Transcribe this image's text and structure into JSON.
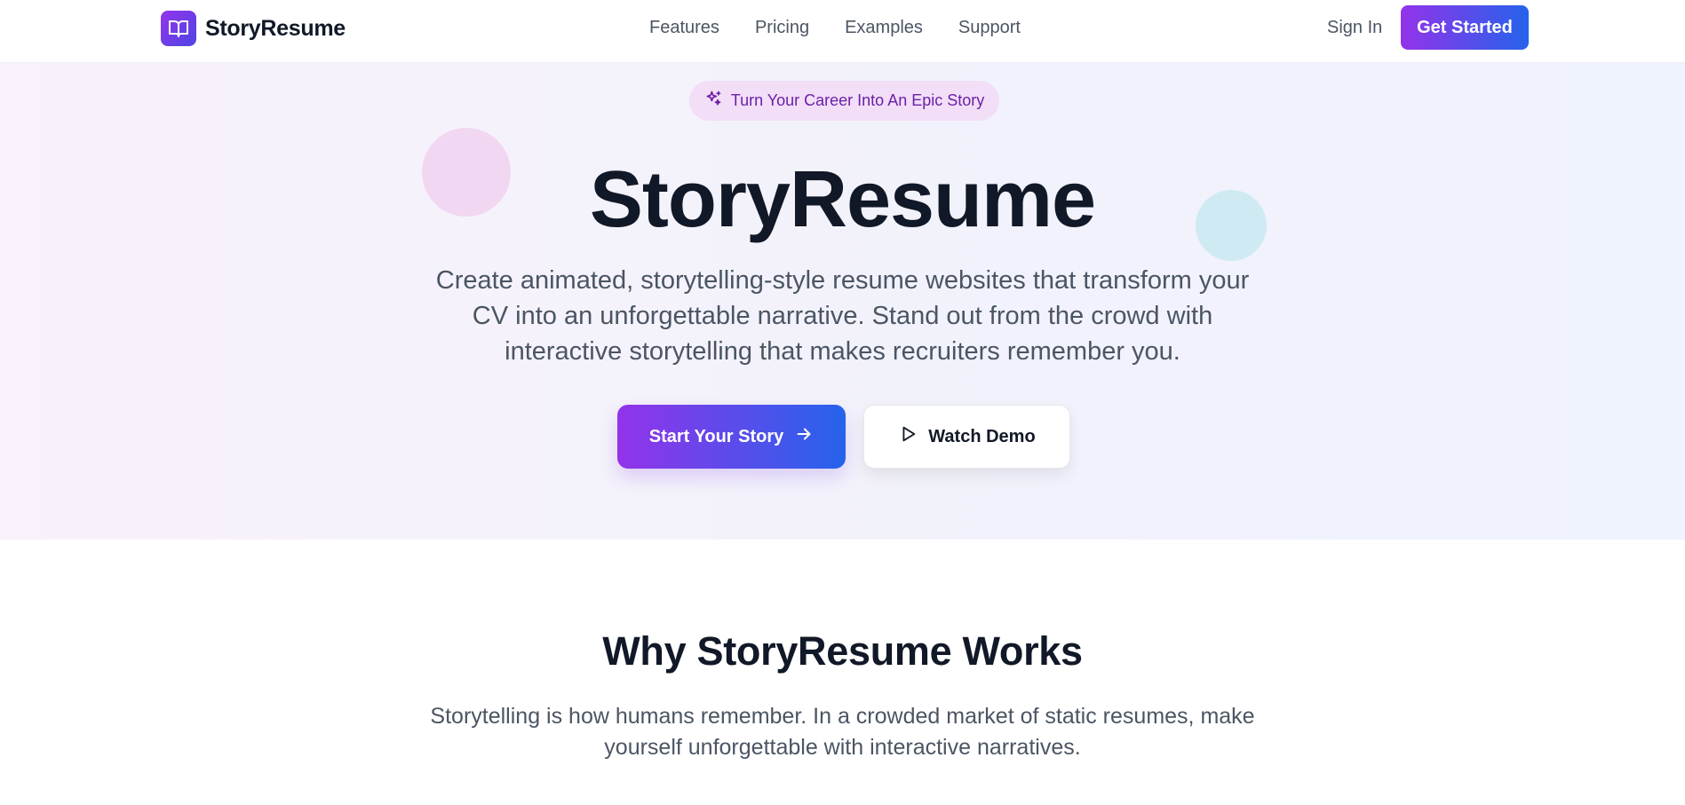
{
  "navbar": {
    "brand": {
      "name": "StoryResume",
      "icon": "book-open-icon"
    },
    "links": [
      {
        "label": "Features"
      },
      {
        "label": "Pricing"
      },
      {
        "label": "Examples"
      },
      {
        "label": "Support"
      }
    ],
    "sign_in_label": "Sign In",
    "get_started_label": "Get Started"
  },
  "hero": {
    "badge": {
      "icon": "sparkles-icon",
      "text": "Turn Your Career Into An Epic Story"
    },
    "title": "StoryResume",
    "description": "Create animated, storytelling-style resume websites that transform your CV into an unforgettable narrative. Stand out from the crowd with interactive storytelling that makes recruiters remember you.",
    "primary_cta": {
      "label": "Start Your Story",
      "icon": "arrow-right-icon"
    },
    "secondary_cta": {
      "label": "Watch Demo",
      "icon": "play-icon"
    }
  },
  "why_section": {
    "title": "Why StoryResume Works",
    "description": "Storytelling is how humans remember. In a crowded market of static resumes, make yourself unforgettable with interactive narratives."
  },
  "colors": {
    "brand_purple": "#9333ea",
    "brand_blue": "#2563eb",
    "text_dark": "#111827",
    "text_muted": "#4b5563",
    "badge_bg": "#f2def7",
    "badge_text": "#6b21a8"
  }
}
